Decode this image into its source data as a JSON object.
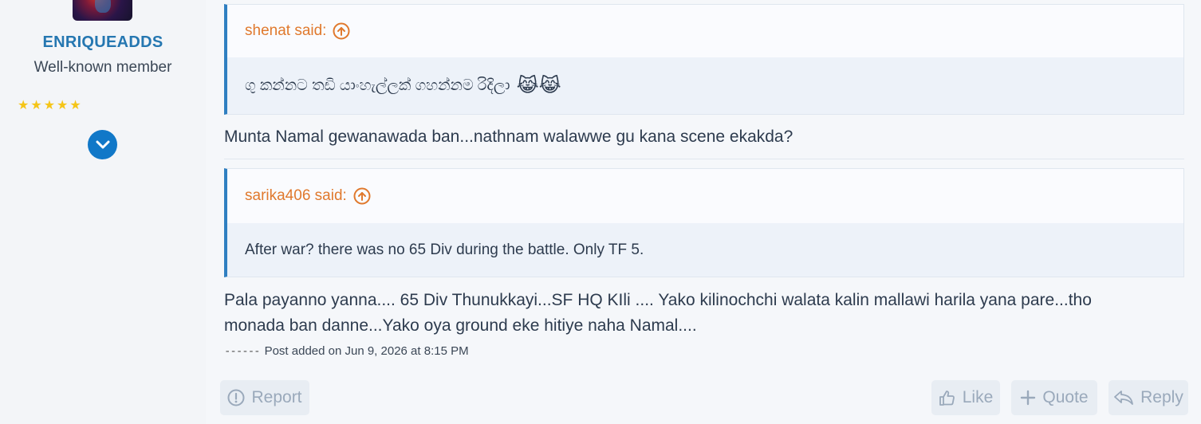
{
  "sidebar": {
    "username": "ENRIQUEADDS",
    "user_title": "Well-known member",
    "stars": "★★★★★"
  },
  "quotes": [
    {
      "author_line": "shenat said:",
      "body": "ගු කන්නට තඩි යාංහැල්ලක් ගහන්නම රිදිලා",
      "emoji": "😹😹"
    },
    {
      "author_line": "sarika406 said:",
      "body": "After war? there was no 65 Div during the battle. Only TF 5."
    }
  ],
  "replies": [
    "Munta Namal gewanawada ban...nathnam walawwe gu kana scene ekakda?",
    "Pala payanno yanna.... 65 Div Thunukkayi...SF HQ KIli .... Yako kilinochchi walata kalin mallawi harila yana pare...tho monada ban danne...Yako oya ground eke hitiye naha Namal...."
  ],
  "post_added": {
    "dashes": "------",
    "text": "Post added on Jun 9, 2026 at 8:15 PM"
  },
  "actions": {
    "report": "Report",
    "like": "Like",
    "quote": "Quote",
    "reply": "Reply"
  },
  "colors": {
    "username": "#2577b1",
    "quote_author": "#e0792d",
    "quote_border": "#2f7fc1",
    "star": "#f5c518"
  }
}
